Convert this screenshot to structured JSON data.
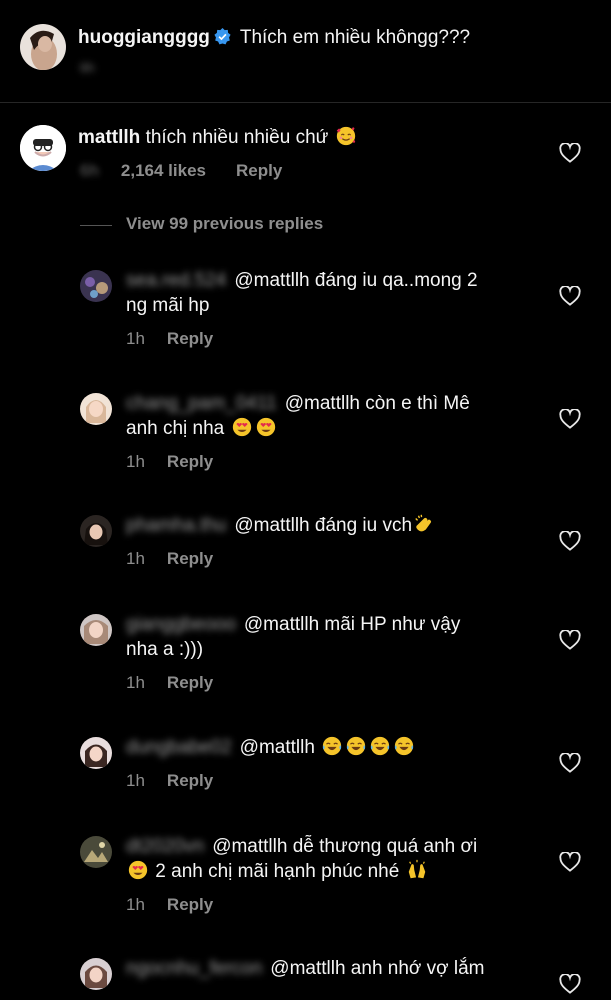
{
  "caption": {
    "username": "huoggiangggg",
    "text": "Thích em nhiều khôngg???",
    "time": "6h"
  },
  "main_comment": {
    "username": "mattllh",
    "text": "thích nhiều nhiều chứ",
    "emoji": "smiling-face-with-hearts",
    "time": "6h",
    "likes": "2,164 likes",
    "reply_label": "Reply"
  },
  "view_previous": "View 99 previous replies",
  "replies": [
    {
      "username": "sea.red.524",
      "text_line1": "@mattllh đáng iu qa..mong 2",
      "text_line2": "ng mãi hp",
      "time": "1h",
      "reply_label": "Reply"
    },
    {
      "username": "chang_pam_0411",
      "text_line1": "@mattllh  còn  e thì  Mê",
      "text_line2": "anh  chị  nha",
      "time": "1h",
      "reply_label": "Reply"
    },
    {
      "username": "phamha.thu",
      "text_line1": "@mattllh đáng iu vch",
      "time": "1h",
      "reply_label": "Reply"
    },
    {
      "username": "gianggbeooo",
      "text_line1": "@mattllh mãi HP như vậy",
      "text_line2": "nha a :)))",
      "time": "1h",
      "reply_label": "Reply"
    },
    {
      "username": "dungbabe02",
      "text_line1": "@mattllh",
      "time": "1h",
      "reply_label": "Reply"
    },
    {
      "username": "dt2020vn",
      "text_line1": "@mattllh dễ thương quá anh ơi",
      "text_line2": "2 anh chị mãi hạnh phúc nhé",
      "time": "1h",
      "reply_label": "Reply"
    },
    {
      "username": "ngocnhu_fercon",
      "text_line1": "@mattllh anh nhớ vợ lắm"
    }
  ],
  "colors": {
    "background": "#000000",
    "text": "#f5f5f5",
    "muted": "#8e8e8e",
    "verified": "#3897f0"
  }
}
